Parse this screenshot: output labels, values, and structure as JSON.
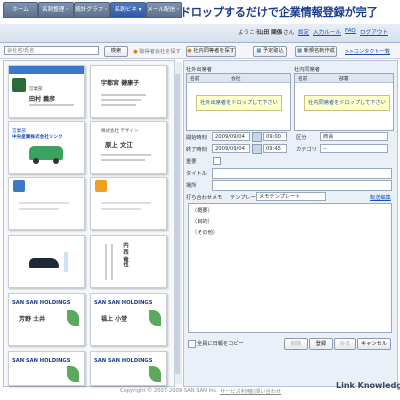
{
  "banner": {
    "title": "【日報作成画面】左の名刺を選択しドロップするだけで企業情報登録が完了"
  },
  "nav": {
    "tabs": [
      {
        "label": "ホーム"
      },
      {
        "label": "名刺整理・"
      },
      {
        "label": "統計グラフ・"
      },
      {
        "label": "名刺ビネ ▾"
      },
      {
        "label": "メール配信・"
      }
    ],
    "active_tab": 3,
    "welcome": "ようこそ",
    "user_name": "山田 関係",
    "honorific": "さん",
    "links": [
      "設定",
      "入力ルール",
      "FAQ",
      "ログアウト"
    ]
  },
  "toolbar": {
    "search_placeholder": "会社名/氏名",
    "search_button": "検索",
    "register_company_label": "取得者会社を探す",
    "find_company_button": "社内同等者を探す",
    "schedule_button": "予定取込",
    "new_card_button": "新規名刺作成",
    "contact_list_link": ">>コンタクト一覧"
  },
  "cards": [
    {
      "company": "株式会社XXX商事",
      "name": "田村 義彦",
      "title": "営業部"
    },
    {
      "company": "",
      "name": "宇都宮 健康子",
      "title": ""
    },
    {
      "company": "中央産業株式会社リンク",
      "name": "",
      "title": "営業部"
    },
    {
      "company": "株式会社 デザイン",
      "name": "原上 文江",
      "title": ""
    },
    {
      "company": "",
      "name": "",
      "title": ""
    },
    {
      "company": "",
      "name": "",
      "title": ""
    },
    {
      "company": "",
      "name": "内 西 竜也",
      "title": ""
    },
    {
      "company": "",
      "name": "",
      "title": ""
    },
    {
      "company": "SAN SAN HOLDINGS",
      "name": "芳野 土井",
      "title": ""
    },
    {
      "company": "SAN SAN HOLDINGS",
      "name": "福上 小堂",
      "title": ""
    },
    {
      "company": "SAN SAN HOLDINGS",
      "name": "",
      "title": ""
    },
    {
      "company": "SAN SAN HOLDINGS",
      "name": "",
      "title": ""
    }
  ],
  "form": {
    "client_label": "社外出席者",
    "internal_label": "社内同席者",
    "col_name": "名前",
    "col_company": "会社",
    "col_department": "部署",
    "drop_client_hint": "社外出席者をドロップして下さい",
    "drop_internal_hint": "社内同席者をドロップして下さい",
    "start_label": "開始時刻",
    "end_label": "終了時刻",
    "start_date": "2009/09/04",
    "start_time": "09:00",
    "end_date": "2009/09/04",
    "end_time": "09:45",
    "category_label": "区分",
    "category_value": "商会",
    "sub_category_label": "カテゴリ",
    "sub_category_value": "--",
    "important_label": "重要",
    "title_label": "タイトル",
    "place_label": "場所",
    "detail_label": "打ち合わせメモ",
    "template_label": "テンプレート",
    "template_value": "メモテンプレート",
    "memo_edit_link": "転送編集",
    "memo_lines": [
      "（概要）",
      "（目的）",
      "（その他）"
    ],
    "copy_checkbox_label": "全員に日報をコピー",
    "delete_button": "削除",
    "save_button": "登録",
    "close_button": "戻る",
    "cancel_button": "キャンセル"
  },
  "footer": {
    "copyright": "Copyright © 2007-2009 SAN SAN Inc.",
    "policy_link": "サービス利用",
    "contact_link": "お問い合わせ",
    "brand": "Link Knowledge"
  },
  "colors": {
    "banner_text": "#1a3a8a",
    "nav_tab": "#5d7190",
    "active_tab": "#2f5aa5",
    "drop_zone": "#ffffc8",
    "link": "#1a4fb8"
  }
}
